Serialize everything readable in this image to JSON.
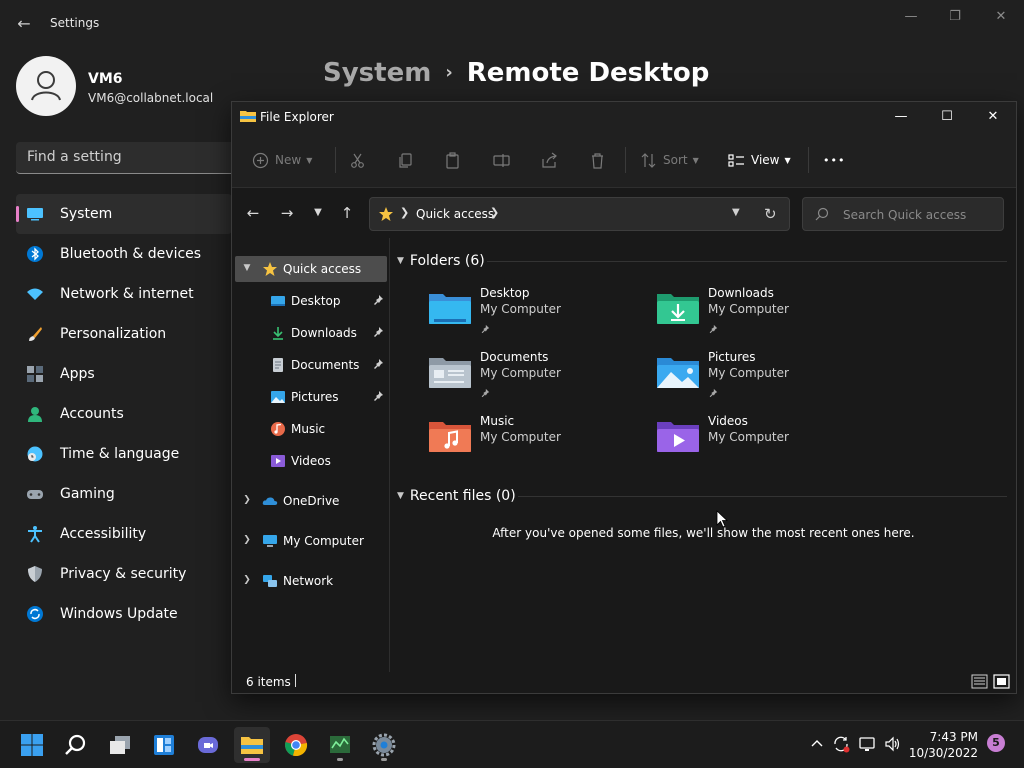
{
  "settings": {
    "title": "Settings",
    "back_glyph": "←",
    "account": {
      "name": "VM6",
      "email": "VM6@collabnet.local"
    },
    "search_placeholder": "Find a setting",
    "breadcrumb": {
      "parent": "System",
      "separator": "›",
      "current": "Remote Desktop"
    },
    "accent_color": "#e780c8",
    "nav": [
      {
        "label": "System",
        "icon": "system-icon",
        "active": true
      },
      {
        "label": "Bluetooth & devices",
        "icon": "bluetooth-icon"
      },
      {
        "label": "Network & internet",
        "icon": "wifi-icon"
      },
      {
        "label": "Personalization",
        "icon": "brush-icon"
      },
      {
        "label": "Apps",
        "icon": "apps-icon"
      },
      {
        "label": "Accounts",
        "icon": "person-icon"
      },
      {
        "label": "Time & language",
        "icon": "clock-globe-icon"
      },
      {
        "label": "Gaming",
        "icon": "gamepad-icon"
      },
      {
        "label": "Accessibility",
        "icon": "accessibility-icon"
      },
      {
        "label": "Privacy & security",
        "icon": "shield-icon"
      },
      {
        "label": "Windows Update",
        "icon": "update-icon"
      }
    ]
  },
  "explorer": {
    "title": "File Explorer",
    "toolbar": {
      "new_label": "New",
      "sort_label": "Sort",
      "view_label": "View",
      "more_glyph": "•••"
    },
    "address": {
      "location": "Quick access"
    },
    "search_placeholder": "Search Quick access",
    "tree": {
      "quick_access": "Quick access",
      "pinned": [
        {
          "label": "Desktop",
          "pinned": true
        },
        {
          "label": "Downloads",
          "pinned": true
        },
        {
          "label": "Documents",
          "pinned": true
        },
        {
          "label": "Pictures",
          "pinned": true
        },
        {
          "label": "Music",
          "pinned": false
        },
        {
          "label": "Videos",
          "pinned": false
        }
      ],
      "roots": [
        "OneDrive",
        "My Computer",
        "Network"
      ]
    },
    "folders_header": "Folders (6)",
    "folders": [
      {
        "name": "Desktop",
        "location": "My Computer",
        "pinned": true,
        "icon": "desktop-folder-icon"
      },
      {
        "name": "Downloads",
        "location": "My Computer",
        "pinned": true,
        "icon": "downloads-folder-icon"
      },
      {
        "name": "Documents",
        "location": "My Computer",
        "pinned": true,
        "icon": "documents-folder-icon"
      },
      {
        "name": "Pictures",
        "location": "My Computer",
        "pinned": true,
        "icon": "pictures-folder-icon"
      },
      {
        "name": "Music",
        "location": "My Computer",
        "pinned": false,
        "icon": "music-folder-icon"
      },
      {
        "name": "Videos",
        "location": "My Computer",
        "pinned": false,
        "icon": "videos-folder-icon"
      }
    ],
    "recent_header": "Recent files (0)",
    "recent_empty": "After you've opened some files, we'll show the most recent ones here.",
    "status": {
      "items": "6 items"
    }
  },
  "taskbar": {
    "apps": [
      "start-icon",
      "search-icon",
      "task-view-icon",
      "widgets-icon",
      "chat-icon",
      "file-explorer-icon",
      "chrome-icon",
      "task-manager-icon",
      "settings-icon"
    ],
    "clock": {
      "time": "7:43 PM",
      "date": "10/30/2022"
    },
    "notifications": "5"
  }
}
